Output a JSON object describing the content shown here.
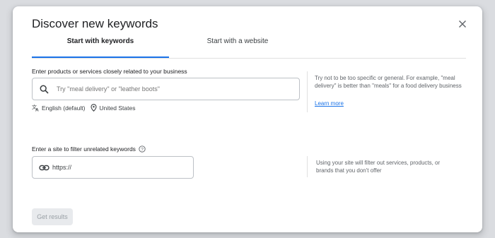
{
  "dialog": {
    "title": "Discover new keywords",
    "close_icon": "close-icon"
  },
  "tabs": [
    {
      "label": "Start with keywords",
      "active": true
    },
    {
      "label": "Start with a website",
      "active": false
    }
  ],
  "keywords_section": {
    "label": "Enter products or services closely related to your business",
    "search_icon": "search-icon",
    "placeholder": "Try \"meal delivery\" or \"leather boots\"",
    "value": "",
    "language": "English (default)",
    "location": "United States",
    "tip": "Try not to be too specific or general. For example, \"meal delivery\" is better than \"meals\" for a food delivery business",
    "learn_more": "Learn more"
  },
  "site_section": {
    "label": "Enter a site to filter unrelated keywords",
    "help_icon": "help-icon",
    "link_icon": "link-icon",
    "value": "https://",
    "tip": "Using your site will filter out services, products, or brands that you don't offer"
  },
  "footer": {
    "get_results_label": "Get results",
    "get_results_enabled": false
  },
  "colors": {
    "accent": "#1a73e8",
    "backdrop": "#dadce0",
    "disabled_bg": "#e8eaed"
  }
}
